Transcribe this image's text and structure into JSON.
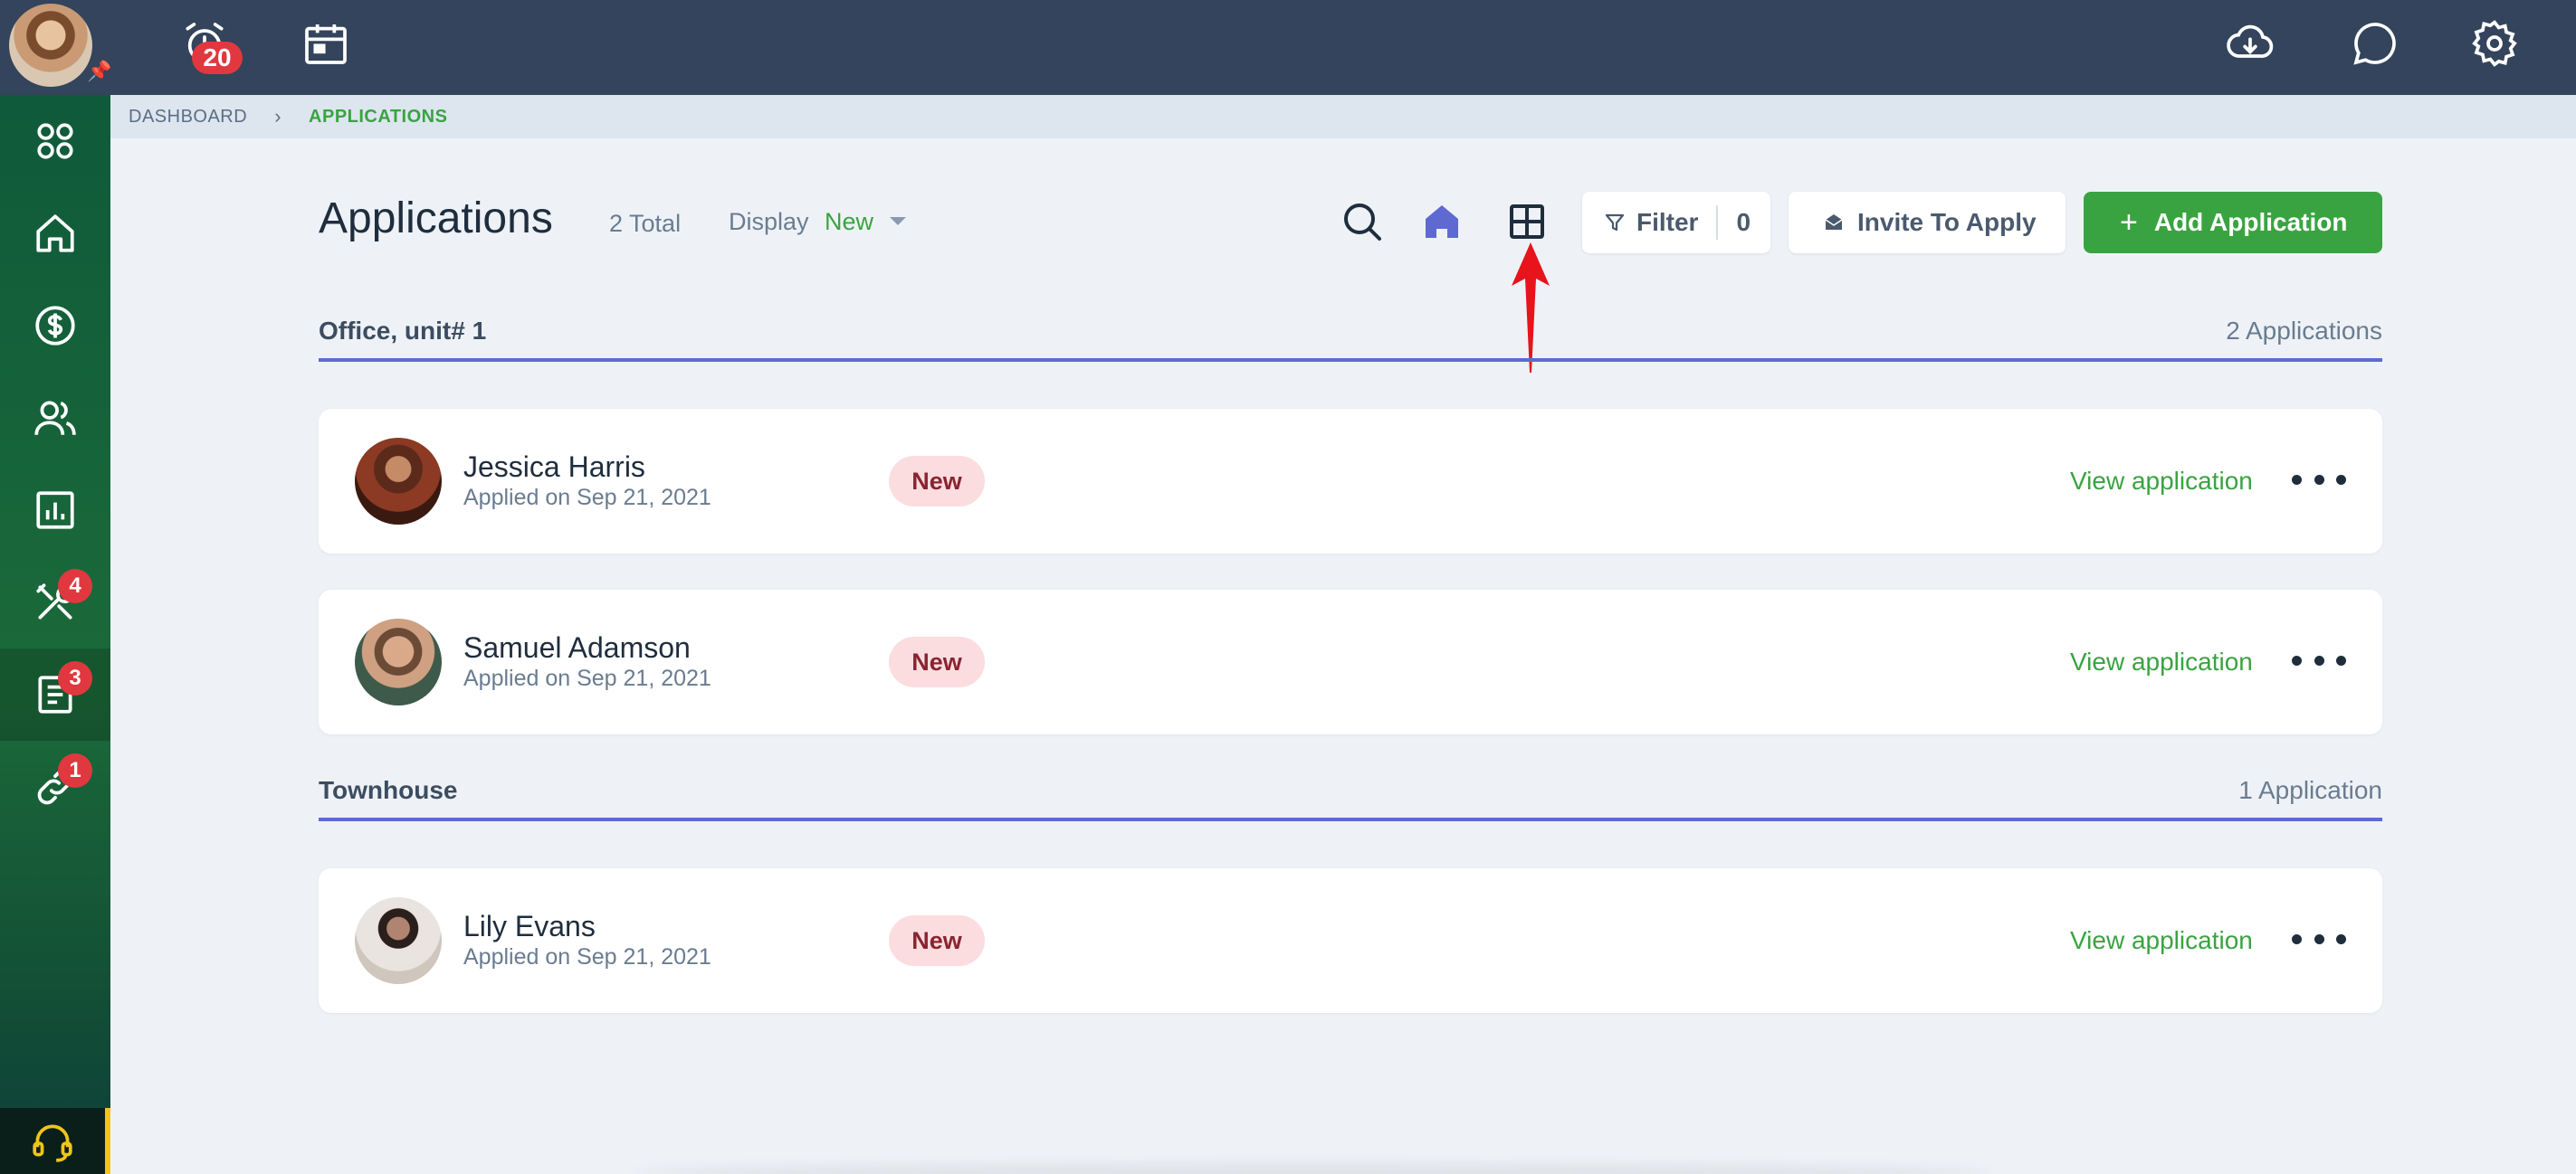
{
  "topbar": {
    "notification_count": "20"
  },
  "sidebar": {
    "items": [
      {
        "name": "dashboard",
        "badge": null
      },
      {
        "name": "properties",
        "badge": null
      },
      {
        "name": "accounting",
        "badge": null
      },
      {
        "name": "people",
        "badge": null
      },
      {
        "name": "reports",
        "badge": null
      },
      {
        "name": "maintenance",
        "badge": "4"
      },
      {
        "name": "applications",
        "badge": "3"
      },
      {
        "name": "links",
        "badge": "1"
      }
    ]
  },
  "breadcrumb": {
    "root": "DASHBOARD",
    "current": "APPLICATIONS"
  },
  "header": {
    "title": "Applications",
    "total": "2 Total",
    "display_label": "Display",
    "display_value": "New",
    "filter_label": "Filter",
    "filter_count": "0",
    "invite_label": "Invite To Apply",
    "add_label": "Add Application"
  },
  "groups": [
    {
      "title": "Office, unit# 1",
      "count": "2 Applications",
      "applications": [
        {
          "name": "Jessica Harris",
          "applied": "Applied on Sep 21, 2021",
          "status": "New",
          "action": "View application"
        },
        {
          "name": "Samuel Adamson",
          "applied": "Applied on Sep 21, 2021",
          "status": "New",
          "action": "View application"
        }
      ]
    },
    {
      "title": "Townhouse",
      "count": "1 Application",
      "applications": [
        {
          "name": "Lily Evans",
          "applied": "Applied on Sep 21, 2021",
          "status": "New",
          "action": "View application"
        }
      ]
    }
  ],
  "colors": {
    "topbar": "#33445c",
    "accent_green": "#3aa341",
    "group_line": "#5e6ad2",
    "status_bg": "#fbdde0",
    "status_text": "#8a2430",
    "annotation_arrow": "#e8141b"
  }
}
